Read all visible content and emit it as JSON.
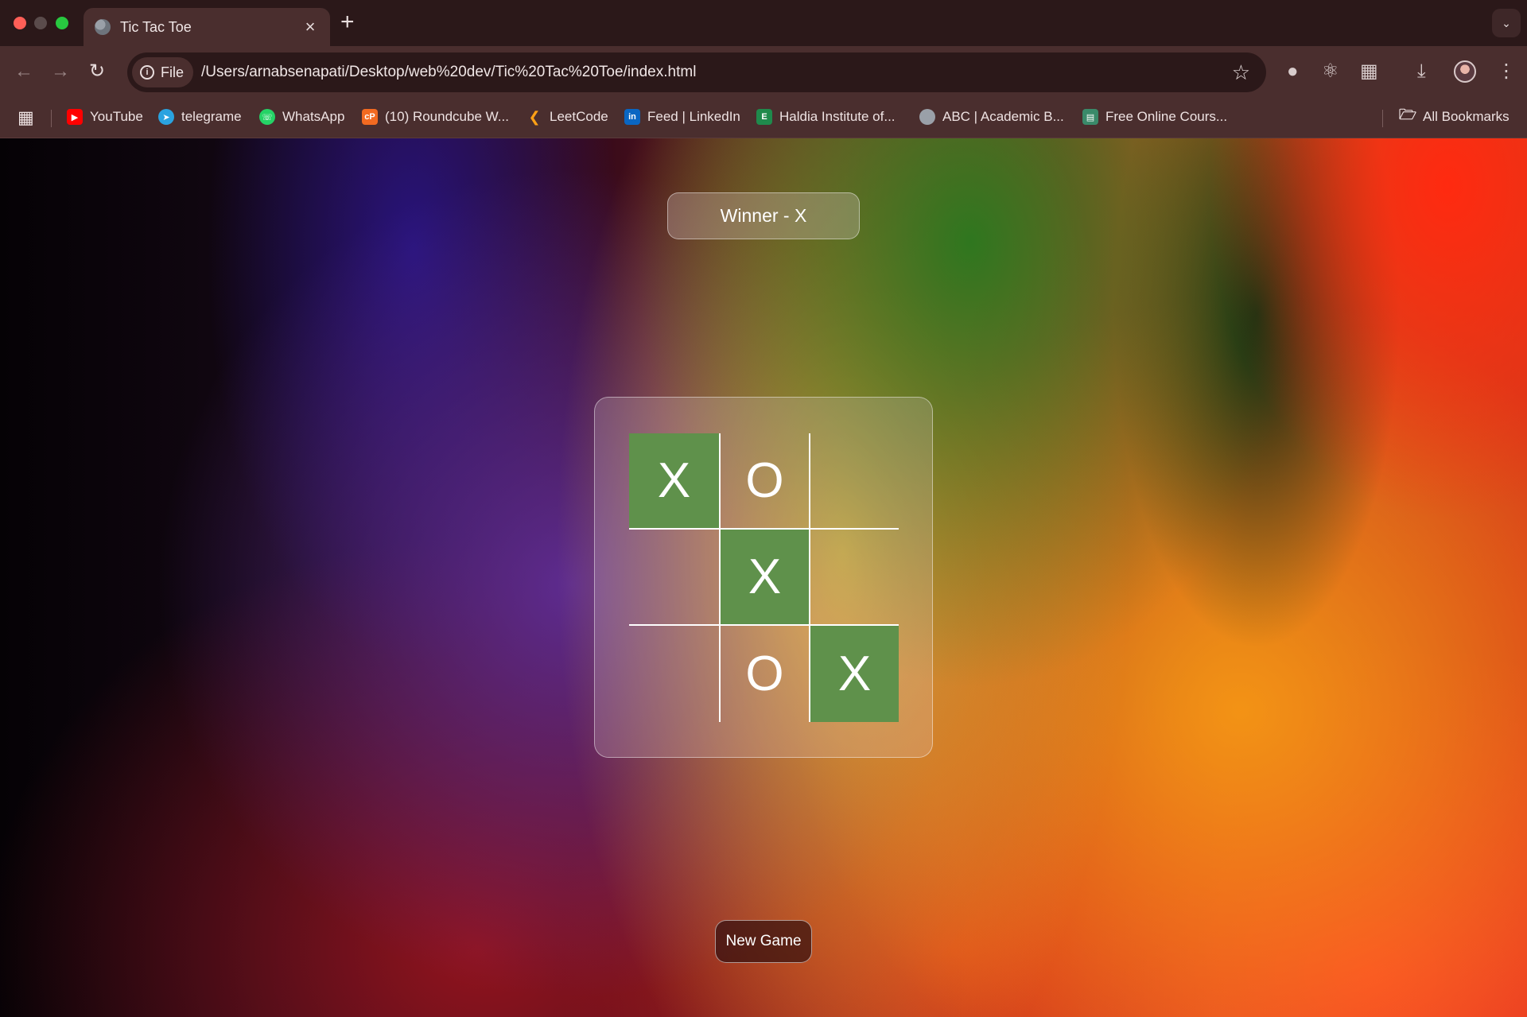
{
  "browser": {
    "tab_title": "Tic Tac Toe",
    "new_tab": "+",
    "close_tab": "×",
    "address": {
      "scheme_chip": "File",
      "url": "/Users/arnabsenapati/Desktop/web%20dev/Tic%20Tac%20Toe/index.html"
    },
    "bookmarks": [
      {
        "label": "YouTube",
        "icon": "youtube-icon",
        "color": "#ff0000"
      },
      {
        "label": "telegrame",
        "icon": "telegram-icon",
        "color": "#2aa3e0"
      },
      {
        "label": "WhatsApp",
        "icon": "whatsapp-icon",
        "color": "#25d366"
      },
      {
        "label": "(10) Roundcube W...",
        "icon": "roundcube-icon",
        "color": "#f26a21"
      },
      {
        "label": "LeetCode",
        "icon": "leetcode-icon",
        "color": "#ffa116"
      },
      {
        "label": "Feed | LinkedIn",
        "icon": "linkedin-icon",
        "color": "#0a66c2"
      },
      {
        "label": "Haldia Institute of...",
        "icon": "hit-icon",
        "color": "#1f8a4c"
      },
      {
        "label": "ABC | Academic B...",
        "icon": "globe-icon",
        "color": "#9aa0a8"
      },
      {
        "label": "Free Online Cours...",
        "icon": "course-icon",
        "color": "#3a8a6a"
      }
    ],
    "all_bookmarks": "All Bookmarks"
  },
  "game": {
    "status": "Winner - X",
    "board": [
      "X",
      "O",
      "",
      "",
      "X",
      "",
      "",
      "O",
      "X"
    ],
    "winning_cells": [
      0,
      4,
      8
    ],
    "win_color": "#5f914b",
    "new_game_label": "New Game"
  }
}
